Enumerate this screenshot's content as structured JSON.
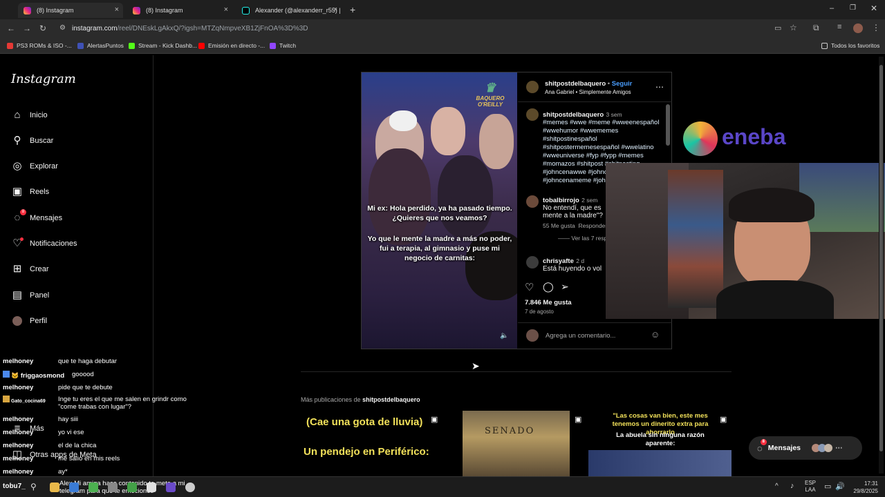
{
  "browser": {
    "tabs": [
      {
        "label": "(8) Instagram",
        "active": true
      },
      {
        "label": "(8) Instagram",
        "active": false
      },
      {
        "label": "Alexander (@alexanderr_r55) |",
        "active": false
      }
    ],
    "url_host": "instagram.com",
    "url_path": "/reel/DNEskLgAkxQ/?igsh=MTZqNmpveXB1ZjFnOA%3D%3D",
    "bookmarks": [
      {
        "label": "PS3 ROMs & ISO -...",
        "color": "#e53935"
      },
      {
        "label": "AlertasPuntos",
        "color": "#3f51b5"
      },
      {
        "label": "Stream - Kick Dashb...",
        "color": "#53fc18"
      },
      {
        "label": "Emisión en directo -...",
        "color": "#ff0000"
      },
      {
        "label": "Twitch",
        "color": "#9146ff"
      }
    ],
    "all_bookmarks": "Todos los favoritos"
  },
  "instagram": {
    "logo": "Instagram",
    "nav": [
      {
        "label": "Inicio",
        "icon": "home-icon"
      },
      {
        "label": "Buscar",
        "icon": "search-icon"
      },
      {
        "label": "Explorar",
        "icon": "compass-icon"
      },
      {
        "label": "Reels",
        "icon": "reels-icon"
      },
      {
        "label": "Mensajes",
        "icon": "messenger-icon",
        "badge": "8"
      },
      {
        "label": "Notificaciones",
        "icon": "heart-icon"
      },
      {
        "label": "Crear",
        "icon": "plus-icon"
      },
      {
        "label": "Panel",
        "icon": "dashboard-icon"
      },
      {
        "label": "Perfil",
        "icon": "avatar-icon"
      }
    ],
    "more": "Más",
    "other_apps": "Otras apps de Meta"
  },
  "post": {
    "video_logo_line1": "BAQUERO",
    "video_logo_line2": "O'REILLY",
    "caption1": "Mi ex: Hola perdido, ya ha pasado tiempo. ¿Quieres que nos veamos?",
    "caption2": "Yo que le mente la madre a más no poder, fui a terapia, al gimnasio y puse mi negocio de carnitas:",
    "author": "shitpostdelbaquero",
    "follow": "Seguir",
    "song": "Ana Gabriel • Simplemente Amigos",
    "caption_author": "shitpostdelbaquero",
    "caption_time": "3 sem",
    "hashtags": [
      "#memes #wwe #meme #wweenespañol",
      "#wwehumor #wwememes",
      "#shitpostinespañol",
      "#shitpostermemesespañol #wwelatino",
      "#wweuniverse #fyp #fypp #memes",
      "#momazos #shitpost #shitposting",
      "#johncenawwe #johnc",
      "#johncenameme #joh"
    ],
    "comments": [
      {
        "user": "tobalbirrojo",
        "time": "2 sem",
        "text1": "No entendí, que es",
        "text2": "mente a la madre\"?",
        "likes": "55 Me gusta",
        "reply": "Responder",
        "replies": "Ver las 7 respuestas"
      },
      {
        "user": "chrisyafte",
        "time": "2 d",
        "text1": "Está huyendo o vol"
      }
    ],
    "likes": "7.846 Me gusta",
    "date": "7 de agosto",
    "comment_placeholder": "Agrega un comentario..."
  },
  "more_posts": {
    "prefix": "Más publicaciones de",
    "author": "shitpostdelbaquero",
    "thumbs": [
      {
        "line1": "(Cae una gota de lluvia)",
        "line2": "Un pendejo en Periférico:"
      },
      {
        "line1": "SENADO"
      },
      {
        "line1": "\"Las cosas van bien, este mes tenemos un dinerito extra para ahorrarlo",
        "line2": "La abuela sin ninguna razón aparente:"
      }
    ]
  },
  "messages_pill": {
    "label": "Mensajes",
    "badge": "8"
  },
  "sponsor": {
    "label": "eneba"
  },
  "chat": [
    {
      "user": "melhoney",
      "text": "que te haga debutar"
    },
    {
      "user": "friggaosmond",
      "text": "gooood"
    },
    {
      "user": "melhoney",
      "text": "pide que te debute"
    },
    {
      "user": "Gato_cocina69",
      "text": "Inge tu eres el que me salen en grindr como \"come trabas con lugar\"?"
    },
    {
      "user": "melhoney",
      "text": "hay siii"
    },
    {
      "user": "melhoney",
      "text": "yo vi ese"
    },
    {
      "user": "melhoney",
      "text": "el de la chica"
    },
    {
      "user": "melhoney",
      "text": "me salio en mis reels"
    },
    {
      "user": "melhoney",
      "text": "ay*"
    },
    {
      "user": "tobu7_",
      "text": "Alex Mi amiga hace contenido te mete a mi telegram para que te emociones"
    }
  ],
  "taskbar": {
    "lang1": "ESP",
    "lang2": "LAA",
    "time": "17:31",
    "date": "29/8/2025"
  }
}
